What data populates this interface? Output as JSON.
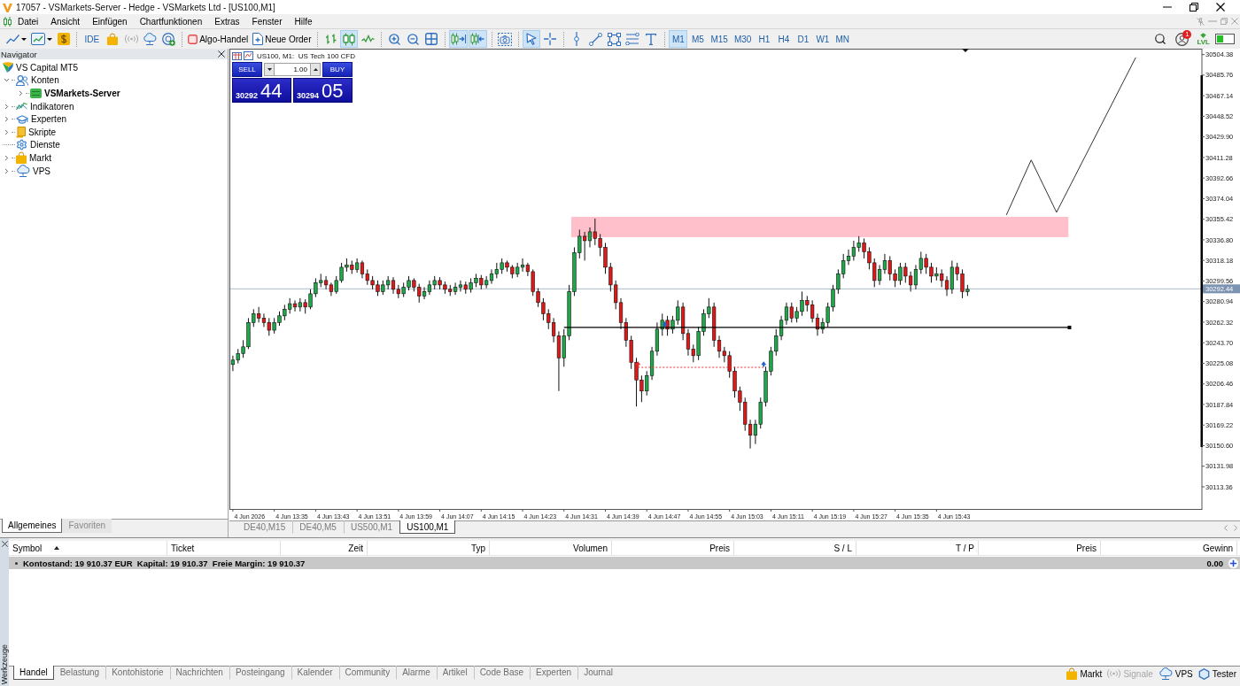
{
  "window": {
    "title": "17057 - VSMarkets-Server - Hedge - VSMarkets Ltd - [US100,M1]"
  },
  "menu": [
    "Datei",
    "Ansicht",
    "Einfügen",
    "Chartfunktionen",
    "Extras",
    "Fenster",
    "Hilfe"
  ],
  "toolbar": {
    "ide": "IDE",
    "algo_trading": "Algo-Handel",
    "new_order": "Neue Order",
    "chart_styles": [
      {
        "selected": false
      },
      {
        "selected": true
      },
      {
        "selected": false
      }
    ],
    "scroll_modes": [
      {
        "selected": true
      },
      {
        "selected": true
      }
    ],
    "pointer_modes": [
      {
        "selected": true
      },
      {
        "selected": false
      }
    ],
    "timeframes": [
      {
        "label": "M1",
        "selected": true
      },
      {
        "label": "M5",
        "selected": false
      },
      {
        "label": "M15",
        "selected": false
      },
      {
        "label": "M30",
        "selected": false
      },
      {
        "label": "H1",
        "selected": false
      },
      {
        "label": "H4",
        "selected": false
      },
      {
        "label": "D1",
        "selected": false
      },
      {
        "label": "W1",
        "selected": false
      },
      {
        "label": "MN",
        "selected": false
      }
    ],
    "notification_count": "1",
    "status_badge": "LVL"
  },
  "navigator": {
    "title": "Navigator",
    "root": "VS Capital MT5",
    "items": [
      {
        "label": "Konten",
        "expanded": true,
        "children": [
          {
            "label": "VSMarkets-Server",
            "expanded": false,
            "active": true
          }
        ]
      },
      {
        "label": "Indikatoren",
        "expanded": false
      },
      {
        "label": "Experten",
        "expanded": false
      },
      {
        "label": "Skripte",
        "expanded": false
      },
      {
        "label": "Dienste"
      },
      {
        "label": "Markt",
        "expanded": false
      },
      {
        "label": "VPS",
        "expanded": false
      }
    ],
    "tabs": [
      {
        "label": "Allgemeines",
        "selected": true
      },
      {
        "label": "Favoriten",
        "selected": false
      }
    ]
  },
  "chart": {
    "header": "US100, M1:  US Tech 100 CFD",
    "trade_panel": {
      "sell": "SELL",
      "buy": "BUY",
      "volume": "1.00",
      "bid_main": "30292",
      "bid_pips": "44",
      "ask_main": "30294",
      "ask_pips": "05"
    },
    "price_labels": [
      "30504.38",
      "30485.76",
      "30467.14",
      "30448.52",
      "30429.90",
      "30411.28",
      "30392.66",
      "30374.04",
      "30355.42",
      "30336.80",
      "30318.18",
      "30299.56",
      "30280.94",
      "30262.32",
      "30243.70",
      "30225.08",
      "30206.46",
      "30187.84",
      "30169.22",
      "30150.60",
      "30131.98",
      "30113.36"
    ],
    "current_price": "30292.44",
    "time_labels": [
      "4 Jun 2026",
      "4 Jun 13:35",
      "4 Jun 13:43",
      "4 Jun 13:51",
      "4 Jun 13:59",
      "4 Jun 14:07",
      "4 Jun 14:15",
      "4 Jun 14:23",
      "4 Jun 14:31",
      "4 Jun 14:39",
      "4 Jun 14:47",
      "4 Jun 14:55",
      "4 Jun 15:03",
      "4 Jun 15:11",
      "4 Jun 15:19",
      "4 Jun 15:27",
      "4 Jun 15:35",
      "4 Jun 15:43"
    ],
    "tabs": [
      {
        "label": "DE40,M15",
        "selected": false
      },
      {
        "label": "DE40,M5",
        "selected": false
      },
      {
        "label": "US500,M1",
        "selected": false
      },
      {
        "label": "US100,M1",
        "selected": true
      }
    ]
  },
  "toolbox": {
    "title": "Werkzeuge",
    "columns": [
      {
        "label": "Symbol",
        "sorted": true
      },
      {
        "label": "Ticket",
        "sorted": false
      },
      {
        "label": "Zeit",
        "sorted": false
      },
      {
        "label": "Typ",
        "sorted": false
      },
      {
        "label": "Volumen",
        "sorted": false
      },
      {
        "label": "Preis",
        "sorted": false
      },
      {
        "label": "S / L",
        "sorted": false
      },
      {
        "label": "T / P",
        "sorted": false
      },
      {
        "label": "Preis",
        "sorted": false
      },
      {
        "label": "Gewinn",
        "sorted": false
      }
    ],
    "summary": {
      "text": "Kontostand: 19 910.37 EUR  Kapital: 19 910.37  Freie Margin: 19 910.37",
      "profit": "0.00"
    },
    "tabs": [
      {
        "label": "Handel",
        "selected": true
      },
      {
        "label": "Belastung",
        "selected": false
      },
      {
        "label": "Kontohistorie",
        "selected": false
      },
      {
        "label": "Nachrichten",
        "selected": false
      },
      {
        "label": "Posteingang",
        "selected": false
      },
      {
        "label": "Kalender",
        "selected": false
      },
      {
        "label": "Community",
        "selected": false
      },
      {
        "label": "Alarme",
        "selected": false
      },
      {
        "label": "Artikel",
        "selected": false
      },
      {
        "label": "Code Base",
        "selected": false
      },
      {
        "label": "Experten",
        "selected": false
      },
      {
        "label": "Journal",
        "selected": false
      }
    ],
    "status_links": [
      {
        "label": "Markt",
        "disabled": false
      },
      {
        "label": "Signale",
        "disabled": true
      },
      {
        "label": "VPS",
        "disabled": false
      },
      {
        "label": "Tester",
        "disabled": false
      }
    ]
  }
}
